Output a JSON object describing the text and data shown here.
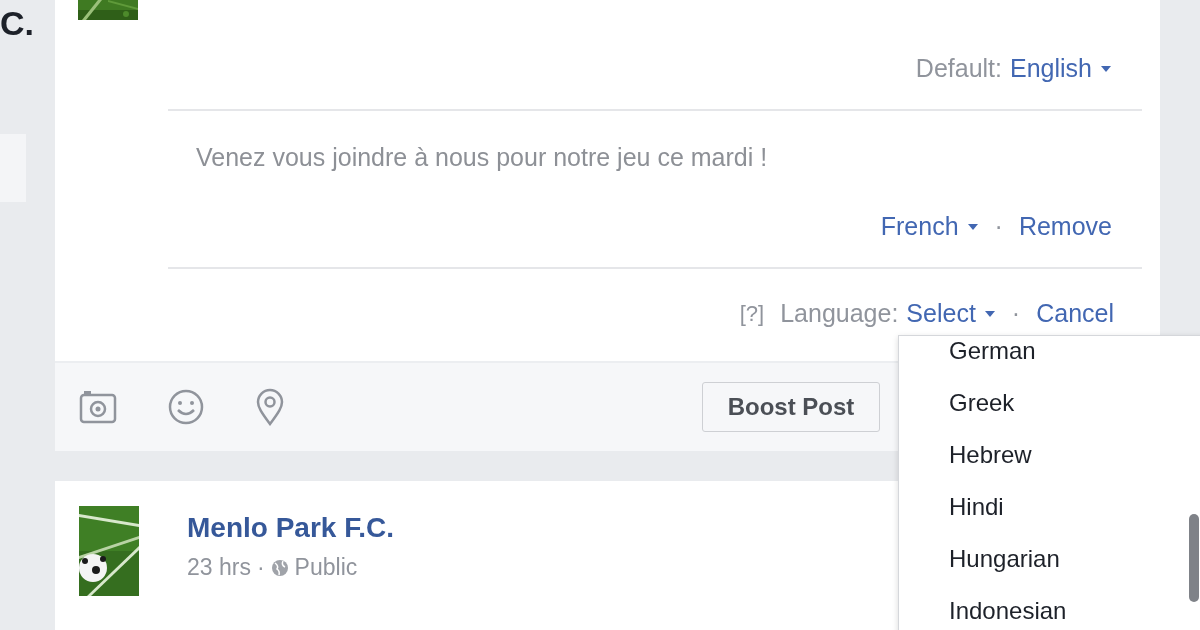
{
  "sidebar": {
    "text": "C."
  },
  "composer": {
    "default_language": {
      "label": "Default:",
      "value": "English"
    },
    "translations": [
      {
        "text": "Venez vous joindre à nous pour notre jeu ce mardi !",
        "language": "French",
        "separator": "·",
        "remove": "Remove"
      }
    ],
    "language_row": {
      "help": "[?]",
      "label": "Language:",
      "select": "Select",
      "separator": "·",
      "cancel": "Cancel"
    },
    "boost_button": "Boost Post"
  },
  "language_menu": {
    "items": [
      {
        "label": "German"
      },
      {
        "label": "Greek"
      },
      {
        "label": "Hebrew"
      },
      {
        "label": "Hindi"
      },
      {
        "label": "Hungarian"
      },
      {
        "label": "Indonesian"
      }
    ]
  },
  "post": {
    "author": "Menlo Park F.C.",
    "time": "23 hrs",
    "separator": "·",
    "audience": "Public"
  }
}
